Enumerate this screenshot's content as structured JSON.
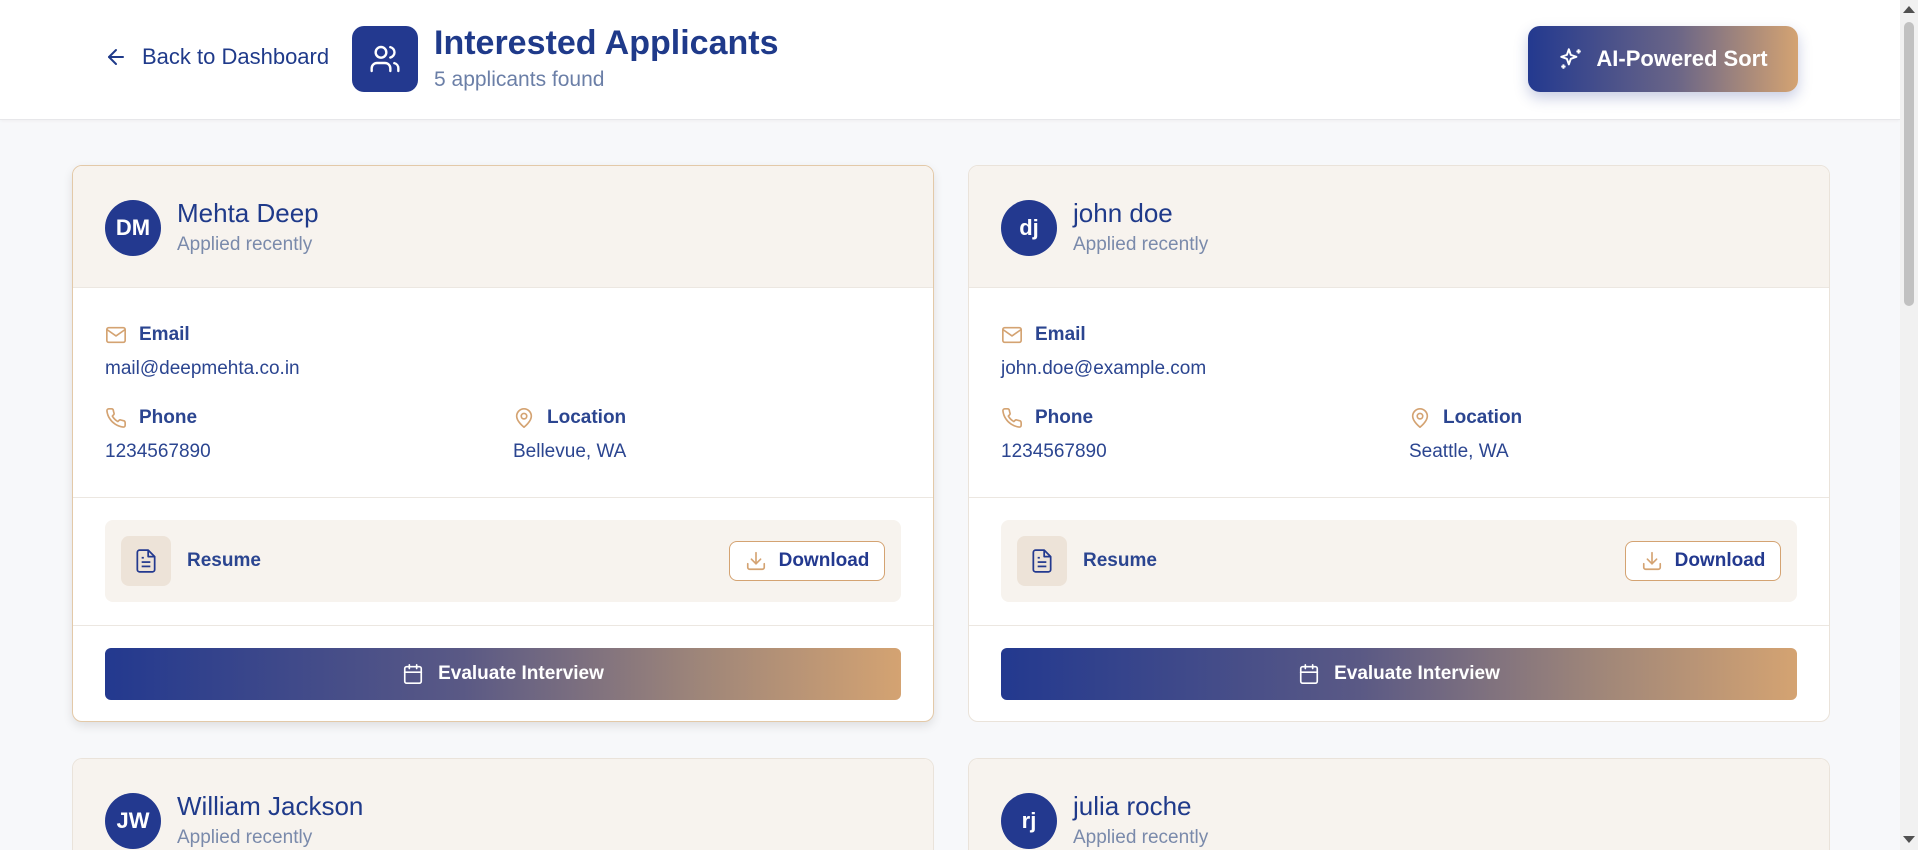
{
  "header": {
    "back_label": "Back to Dashboard",
    "title": "Interested Applicants",
    "subtitle": "5 applicants found",
    "ai_sort_label": "AI-Powered Sort"
  },
  "labels": {
    "email": "Email",
    "phone": "Phone",
    "location": "Location",
    "resume": "Resume",
    "download": "Download",
    "evaluate": "Evaluate Interview"
  },
  "applicants": [
    {
      "initials": "DM",
      "name": "Mehta Deep",
      "applied": "Applied recently",
      "email": "mail@deepmehta.co.in",
      "phone": "1234567890",
      "location": "Bellevue, WA"
    },
    {
      "initials": "dj",
      "name": "john doe",
      "applied": "Applied recently",
      "email": "john.doe@example.com",
      "phone": "1234567890",
      "location": "Seattle, WA"
    },
    {
      "initials": "JW",
      "name": "William Jackson",
      "applied": "Applied recently"
    },
    {
      "initials": "rj",
      "name": "julia roche",
      "applied": "Applied recently"
    }
  ],
  "colors": {
    "primary": "#23398f",
    "accent": "#d4a372",
    "card_header_bg": "#f7f3ee",
    "page_bg": "#f7f8fa"
  },
  "icons": {
    "back": "arrow-left-icon",
    "header": "users-icon",
    "ai_sort": "sparkles-icon",
    "email": "mail-icon",
    "phone": "phone-icon",
    "location": "map-pin-icon",
    "resume": "file-text-icon",
    "download": "download-icon",
    "evaluate": "calendar-icon"
  }
}
